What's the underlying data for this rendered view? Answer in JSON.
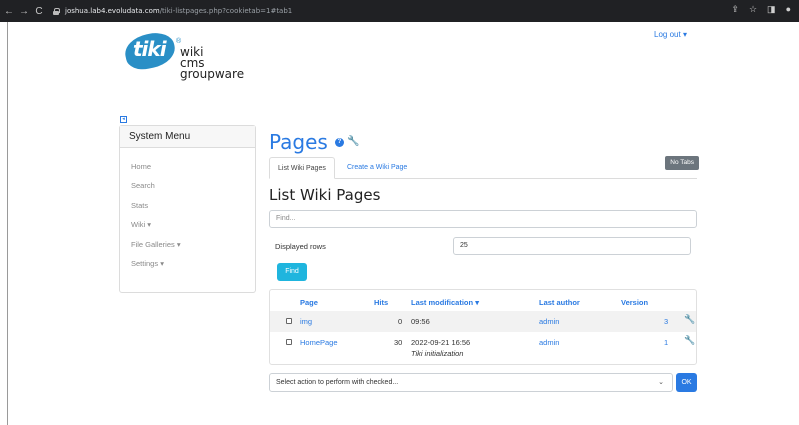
{
  "browser": {
    "url_host": "joshua.lab4.evoludata.com",
    "url_path": "/tiki-listpages.php?cookietab=1#tab1"
  },
  "logo": {
    "mark": "tiki",
    "reg": "®",
    "lines": [
      "wiki",
      "cms",
      "groupware"
    ]
  },
  "header": {
    "logout_label": "Log out"
  },
  "system_menu": {
    "title": "System Menu",
    "items": [
      {
        "label": "Home"
      },
      {
        "label": "Search"
      },
      {
        "label": "Stats"
      },
      {
        "label": "Wiki"
      },
      {
        "label": "File Galleries"
      },
      {
        "label": "Settings"
      }
    ]
  },
  "page": {
    "title": "Pages",
    "tabs": [
      {
        "label": "List Wiki Pages",
        "active": true
      },
      {
        "label": "Create a Wiki Page",
        "active": false
      }
    ],
    "no_tabs_label": "No Tabs",
    "section_title": "List Wiki Pages",
    "find_placeholder": "Find...",
    "displayed_rows_label": "Displayed rows",
    "displayed_rows_value": "25",
    "find_button": "Find",
    "table": {
      "columns": [
        "Page",
        "Hits",
        "Last modification",
        "Last author",
        "Version"
      ],
      "rows": [
        {
          "page": "img",
          "hits": "0",
          "modified": "09:56",
          "note": "",
          "author": "admin",
          "version": "3"
        },
        {
          "page": "HomePage",
          "hits": "30",
          "modified": "2022-09-21 16:56",
          "note": "Tiki initialization",
          "author": "admin",
          "version": "1"
        }
      ]
    },
    "action_placeholder": "Select action to perform with checked...",
    "ok_button": "OK"
  },
  "colors": {
    "accent": "#2a7ae2",
    "find_button": "#1fb5de",
    "logo_blue": "#2a8fc6"
  }
}
